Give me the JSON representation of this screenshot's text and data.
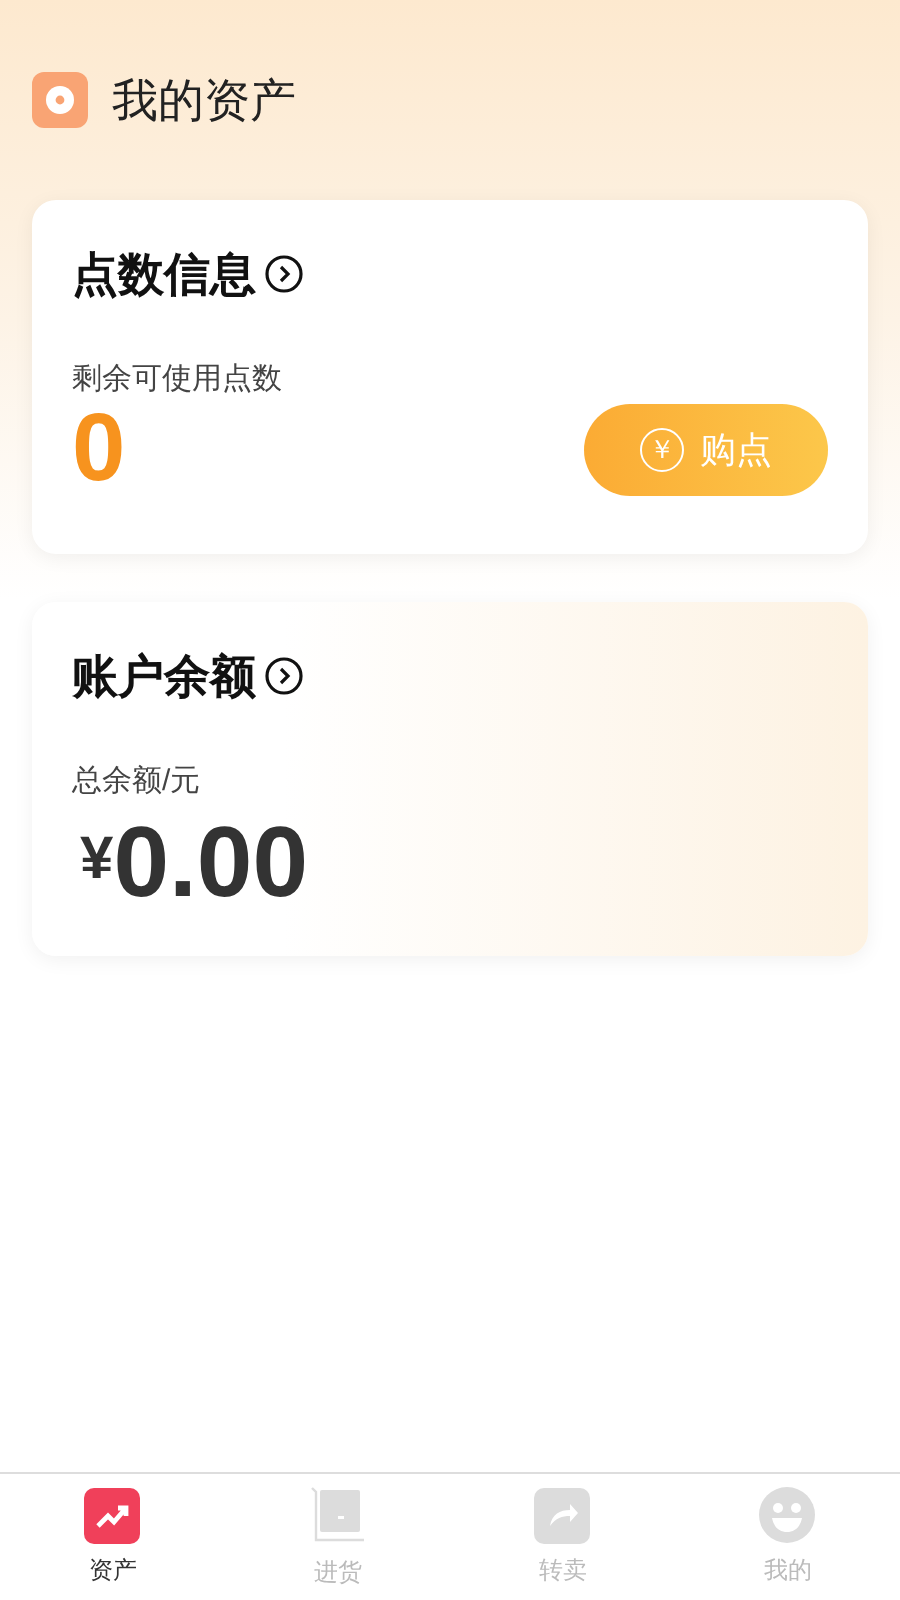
{
  "header": {
    "title": "我的资产"
  },
  "points_card": {
    "title": "点数信息",
    "label": "剩余可使用点数",
    "value": "0",
    "button": {
      "icon": "￥",
      "label": "购点"
    }
  },
  "balance_card": {
    "title": "账户余额",
    "label": "总余额/元",
    "currency": "¥",
    "value": "0.00"
  },
  "tabs": [
    {
      "kind": "assets",
      "label": "资产",
      "selected": true
    },
    {
      "kind": "purchase",
      "label": "进货",
      "selected": false
    },
    {
      "kind": "resell",
      "label": "转卖",
      "selected": false
    },
    {
      "kind": "mine",
      "label": "我的",
      "selected": false
    }
  ]
}
